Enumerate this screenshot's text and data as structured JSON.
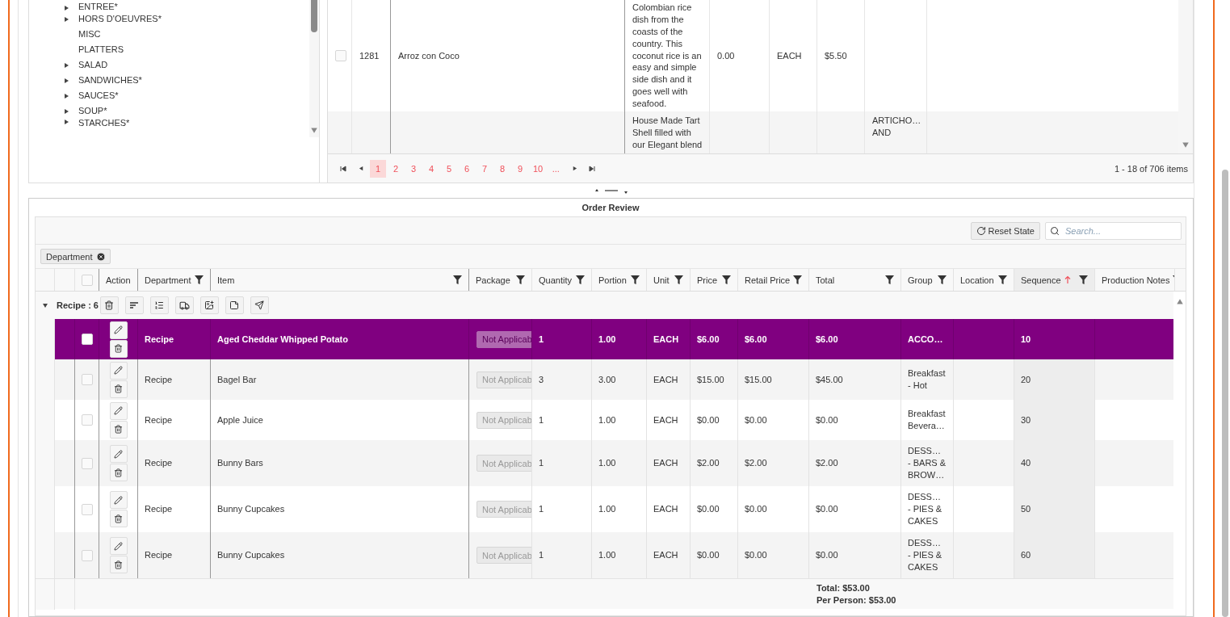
{
  "category_tree": {
    "items": [
      {
        "label": "ENTREE*",
        "expandable": true
      },
      {
        "label": "HORS D'OEUVRES*",
        "expandable": true
      },
      {
        "label": "MISC",
        "expandable": false
      },
      {
        "label": "PLATTERS",
        "expandable": false
      },
      {
        "label": "SALAD",
        "expandable": true
      },
      {
        "label": "SANDWICHES*",
        "expandable": true
      },
      {
        "label": "SAUCES*",
        "expandable": true
      },
      {
        "label": "SOUP*",
        "expandable": true
      },
      {
        "label": "STARCHES*",
        "expandable": true
      }
    ]
  },
  "item_grid": {
    "rows": [
      {
        "checked": false,
        "column_2": "1281",
        "column_3": "Arroz con Coco",
        "column_4": "Colombian rice dish from the coasts of the country. This coconut rice is an easy and simple side dish and it goes well with seafood.",
        "column_5": "0.00",
        "column_6": "EACH",
        "column_7": "$5.50"
      },
      {
        "column_4": "House Made Tart Shell filled with our Elegant blend",
        "column_8": "ARTICHO… AND"
      }
    ],
    "pager": {
      "pages": [
        {
          "label": "1",
          "selected": true
        },
        {
          "label": "2",
          "selected": false
        },
        {
          "label": "3",
          "selected": false
        },
        {
          "label": "4",
          "selected": false
        },
        {
          "label": "5",
          "selected": false
        },
        {
          "label": "6",
          "selected": false
        },
        {
          "label": "7",
          "selected": false
        },
        {
          "label": "8",
          "selected": false
        },
        {
          "label": "9",
          "selected": false
        },
        {
          "label": "10",
          "selected": false
        },
        {
          "label": "...",
          "selected": false
        }
      ],
      "summary": "1 - 18 of 706 items"
    }
  },
  "order_review": {
    "title": "Order Review",
    "reset_button": "Reset State",
    "search": {
      "placeholder": "Search..."
    },
    "select_all_checked": false,
    "group_chips": [
      {
        "label": "Department"
      }
    ],
    "columns": [
      {
        "label": "Action",
        "filter": false
      },
      {
        "label": "Department",
        "filter": true
      },
      {
        "label": "Item",
        "filter": true
      },
      {
        "label": "Package",
        "filter": true
      },
      {
        "label": "Quantity",
        "filter": true
      },
      {
        "label": "Portion",
        "filter": true
      },
      {
        "label": "Unit",
        "filter": true
      },
      {
        "label": "Price",
        "filter": true
      },
      {
        "label": "Retail Price",
        "filter": true
      },
      {
        "label": "Total",
        "filter": true
      },
      {
        "label": "Group",
        "filter": true
      },
      {
        "label": "Location",
        "filter": true
      },
      {
        "label": "Sequence",
        "filter": true,
        "sort_ascending": true
      },
      {
        "label": "Production Notes",
        "filter": true
      }
    ],
    "group_row": {
      "label": "Recipe : 6",
      "expanded": true
    },
    "rows": [
      {
        "selected": true,
        "checked": false,
        "department": "Recipe",
        "item": "Aged Cheddar Whipped Potato",
        "package": "Not Applicab",
        "quantity": "1",
        "portion": "1.00",
        "unit": "EACH",
        "price": "$6.00",
        "retail_price": "$6.00",
        "total": "$6.00",
        "group": "ACCO…",
        "sequence": "10"
      },
      {
        "selected": false,
        "checked": false,
        "department": "Recipe",
        "item": "Bagel Bar",
        "package": "Not Applicab",
        "quantity": "3",
        "portion": "3.00",
        "unit": "EACH",
        "price": "$15.00",
        "retail_price": "$15.00",
        "total": "$45.00",
        "group": "Breakfast\n- Hot",
        "sequence": "20"
      },
      {
        "selected": false,
        "checked": false,
        "department": "Recipe",
        "item": "Apple Juice",
        "package": "Not Applicab",
        "quantity": "1",
        "portion": "1.00",
        "unit": "EACH",
        "price": "$0.00",
        "retail_price": "$0.00",
        "total": "$0.00",
        "group": "Breakfast\nBevera…",
        "sequence": "30"
      },
      {
        "selected": false,
        "checked": false,
        "department": "Recipe",
        "item": "Bunny Bars",
        "package": "Not Applicab",
        "quantity": "1",
        "portion": "1.00",
        "unit": "EACH",
        "price": "$2.00",
        "retail_price": "$2.00",
        "total": "$2.00",
        "group": "DESS…\n- BARS &\nBROW…",
        "sequence": "40"
      },
      {
        "selected": false,
        "checked": false,
        "department": "Recipe",
        "item": "Bunny Cupcakes",
        "package": "Not Applicab",
        "quantity": "1",
        "portion": "1.00",
        "unit": "EACH",
        "price": "$0.00",
        "retail_price": "$0.00",
        "total": "$0.00",
        "group": "DESS…\n- PIES &\nCAKES",
        "sequence": "50"
      },
      {
        "selected": false,
        "checked": false,
        "department": "Recipe",
        "item": "Bunny Cupcakes",
        "package": "Not Applicab",
        "quantity": "1",
        "portion": "1.00",
        "unit": "EACH",
        "price": "$0.00",
        "retail_price": "$0.00",
        "total": "$0.00",
        "group": "DESS…\n- PIES &\nCAKES",
        "sequence": "60"
      }
    ],
    "footer": {
      "total": "Total: $53.00",
      "per_person": "Per Person: $53.00"
    }
  }
}
